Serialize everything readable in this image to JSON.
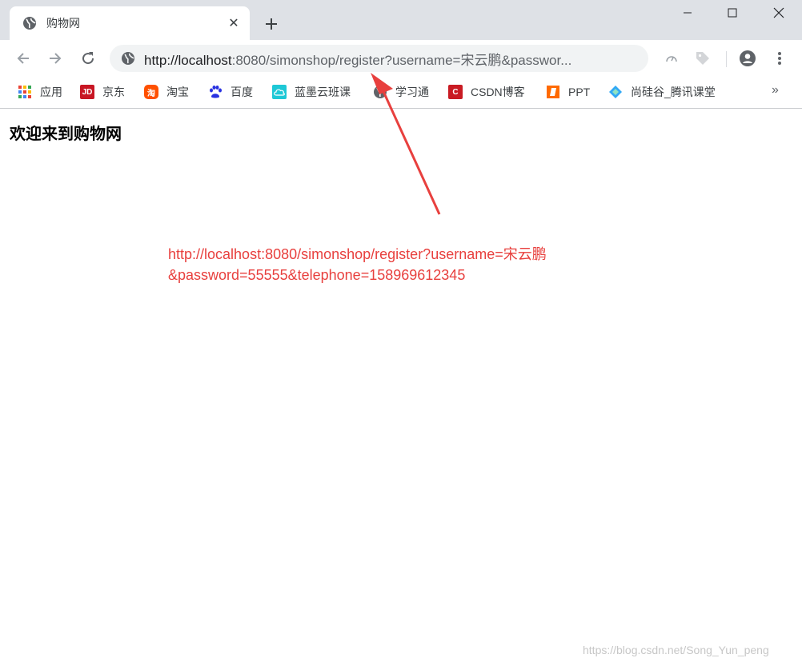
{
  "tab": {
    "title": "购物网",
    "favicon": "globe-icon",
    "close": "✕",
    "new_tab": "new-tab-plus-icon"
  },
  "toolbar": {
    "back": "arrow-left-icon",
    "forward": "arrow-right-icon",
    "reload": "reload-icon",
    "url_host": "http://localhost",
    "url_rest": ":8080/simonshop/register?username=宋云鹏&passwor...",
    "site_info": "globe-icon"
  },
  "bookmarks": [
    {
      "label": "应用",
      "icon": "apps-grid-icon",
      "color": "#ea4335"
    },
    {
      "label": "京东",
      "icon": "jd-icon",
      "color": "#c81623"
    },
    {
      "label": "淘宝",
      "icon": "taobao-icon",
      "color": "#ff5000"
    },
    {
      "label": "百度",
      "icon": "baidu-paw-icon",
      "color": "#2932e1"
    },
    {
      "label": "蓝墨云班课",
      "icon": "cloud-icon",
      "color": "#1ec8d6"
    },
    {
      "label": "学习通",
      "icon": "xuexitong-icon",
      "color": "#5f6368"
    },
    {
      "label": "CSDN博客",
      "icon": "csdn-icon",
      "color": "#c91b23"
    },
    {
      "label": "PPT",
      "icon": "ppt-icon",
      "color": "#ff6a00"
    },
    {
      "label": "尚硅谷_腾讯课堂",
      "icon": "tencent-classroom-icon",
      "color": "#32a9f5"
    }
  ],
  "bookmarks_more": "»",
  "page": {
    "heading": "欢迎来到购物网",
    "annotation_line1": "http://localhost:8080/simonshop/register?username=宋云鹏",
    "annotation_line2": "&password=55555&telephone=158969612345",
    "annotation_color": "#e8403e",
    "watermark": "https://blog.csdn.net/Song_Yun_peng"
  }
}
